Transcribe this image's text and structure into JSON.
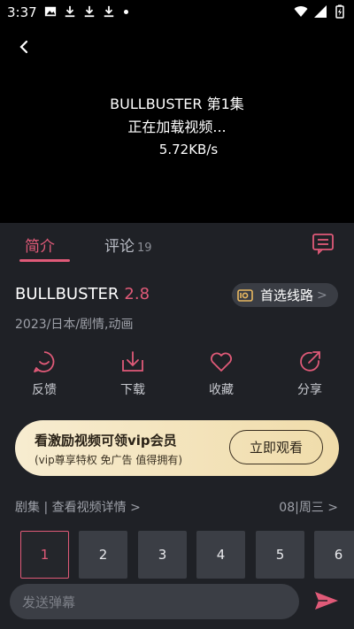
{
  "status_bar": {
    "time": "3:37"
  },
  "video": {
    "title": "BULLBUSTER 第1集",
    "loading_text": "正在加载视频...",
    "speed": "5.72KB/s"
  },
  "tabs": {
    "intro": "简介",
    "comments": "评论",
    "comments_count": "19"
  },
  "show": {
    "title": "BULLBUSTER",
    "score": "2.8",
    "route_label": "首选线路",
    "route_chevron": ">",
    "meta": "2023/日本/剧情,动画"
  },
  "actions": [
    {
      "label": "反馈",
      "icon": "feedback-icon"
    },
    {
      "label": "下载",
      "icon": "download-icon"
    },
    {
      "label": "收藏",
      "icon": "heart-icon"
    },
    {
      "label": "分享",
      "icon": "share-icon"
    }
  ],
  "vip": {
    "title": "看激励视频可领vip会员",
    "subtitle": "(vip尊享特权 免广告 值得拥有)",
    "button": "立即观看"
  },
  "episodes": {
    "header": "剧集 | 查看视频详情 >",
    "schedule": "08|周三 >",
    "items": [
      "1",
      "2",
      "3",
      "4",
      "5",
      "6"
    ],
    "selected": "1"
  },
  "bottom": {
    "danmu_placeholder": "发送弹幕"
  },
  "colors": {
    "accent": "#e05a78",
    "panel_bg": "#1f2126",
    "video_bg": "#000000",
    "vip_gold": "#f0dcaa"
  }
}
